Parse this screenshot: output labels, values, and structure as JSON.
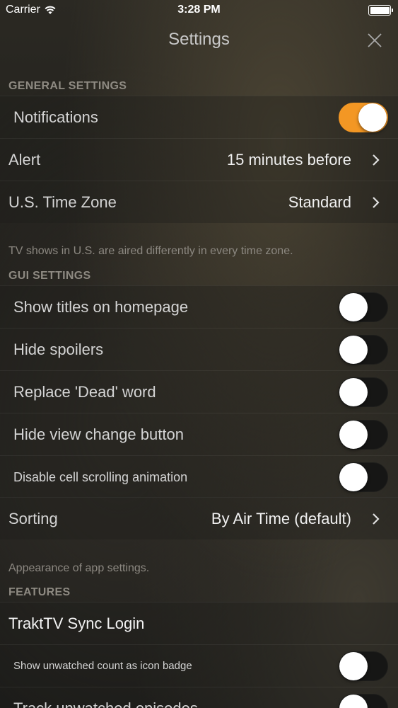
{
  "status_bar": {
    "carrier": "Carrier",
    "time": "3:28 PM"
  },
  "nav": {
    "title": "Settings"
  },
  "general": {
    "header": "GENERAL SETTINGS",
    "notifications_label": "Notifications",
    "notifications_on": true,
    "alert_label": "Alert",
    "alert_value": "15 minutes before",
    "timezone_label": "U.S. Time Zone",
    "timezone_value": "Standard",
    "footer": "TV shows in U.S. are aired differently in every time zone."
  },
  "gui": {
    "header": "GUI SETTINGS",
    "items": [
      {
        "label": "Show titles on homepage",
        "on": false
      },
      {
        "label": "Hide spoilers",
        "on": false
      },
      {
        "label": "Replace 'Dead' word",
        "on": false
      },
      {
        "label": "Hide view change button",
        "on": false
      },
      {
        "label": "Disable cell scrolling animation",
        "on": false
      }
    ],
    "sorting_label": "Sorting",
    "sorting_value": "By Air Time (default)",
    "footer": "Appearance of app settings."
  },
  "features": {
    "header": "FEATURES",
    "trakt_label": "TraktTV Sync Login",
    "items": [
      {
        "label": "Show unwatched count as icon badge",
        "on": false
      },
      {
        "label": "Track unwatched episodes",
        "on": false
      }
    ]
  },
  "colors": {
    "accent": "#f39724"
  },
  "icons": [
    "wifi-icon",
    "battery-icon",
    "close-icon",
    "chevron-right-icon"
  ]
}
